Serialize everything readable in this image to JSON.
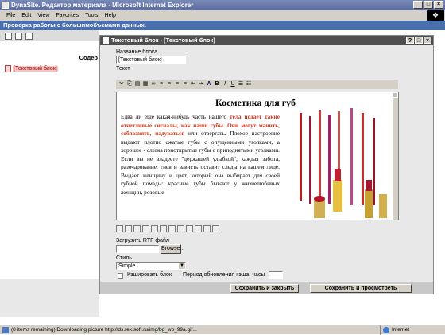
{
  "ie_window": {
    "title": "DynaSite. Редактор материала - Microsoft Internet Explorer",
    "min": "_",
    "max": "□",
    "close": "×"
  },
  "menu": [
    "File",
    "Edit",
    "View",
    "Favorites",
    "Tools",
    "Help"
  ],
  "app_header": "Проверка работы с большимобъемами данных.",
  "left_pane": {
    "caption": "Содер",
    "tree_item": "[Текстовый блок]"
  },
  "dialog": {
    "title": "Текстовый блок - [Текстовый блок]",
    "help": "?",
    "max": "□",
    "close": "×",
    "name_label": "Название блока",
    "name_value": "[Текстовый блок]",
    "text_label": "Текст",
    "editor": {
      "heading": "Косметика для губ",
      "p1": "Едва ли еще какая-нибудь часть нашего",
      "p1_red": "тела подает такие отчетливые сигналы, как наши губы. Они могут манить, соблазнять, надуваться",
      "p1_rest": "или отвергать. Плохое настроение выдают плотно сжатые губы с опущенными уголками, а хорошее - слегка приоткрытые губы с приподнятыми уголками. Если вы не владеете \"держащей улыбкой\", каждая забота, разочарование, гнев и зависть оставит следы на вашем лице. Выдает женщину и цвет, который она выбирает для своей губной помады: красные губы бывают у жизнелюбивых женщин, розовые"
    },
    "upload_label": "Загрузить RTF файл",
    "browse": "Browse...",
    "style_label": "Стиль",
    "style_value": "Simple",
    "cache_label": "Кэшировать блок",
    "cache_period_label": "Период обновления кэша, часы",
    "save_close": "Сохранить и закрыть",
    "save_view": "Сохранить и просмотреть"
  },
  "status_bar": {
    "text": "(8 items remaining) Downloading picture http://ds.rek.soft.ru/img/bg_wp_99a.gif...",
    "zone": "Internet"
  }
}
